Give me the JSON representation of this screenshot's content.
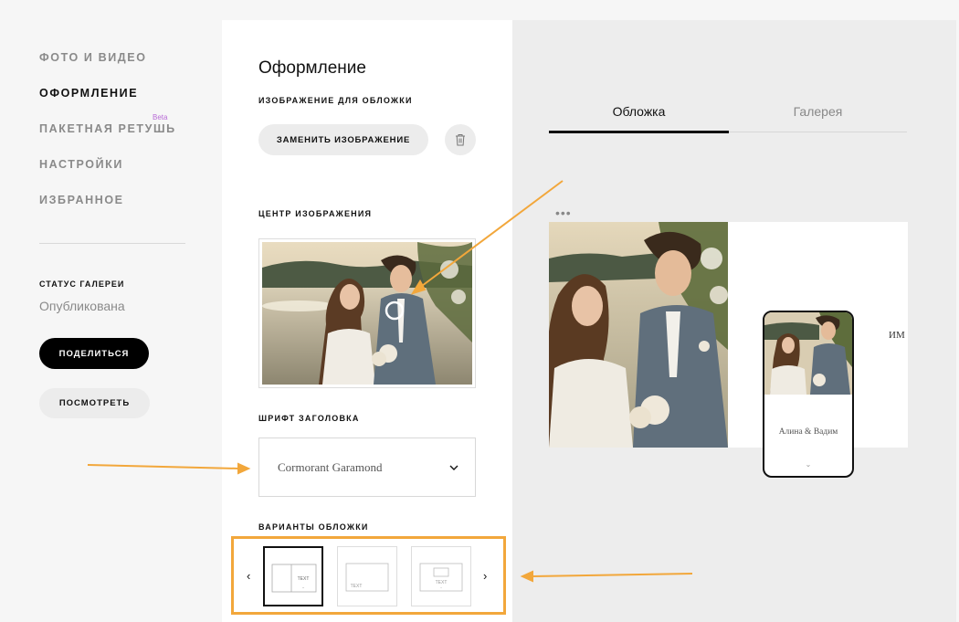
{
  "nav": {
    "items": [
      {
        "label": "ФОТО И ВИДЕО"
      },
      {
        "label": "ОФОРМЛЕНИЕ"
      },
      {
        "label": "ПАКЕТНАЯ РЕТУШЬ"
      },
      {
        "label": "НАСТРОЙКИ"
      },
      {
        "label": "ИЗБРАННОЕ"
      }
    ],
    "beta_badge": "Beta",
    "status_label": "СТАТУС ГАЛЕРЕИ",
    "status_value": "Опубликована",
    "share_label": "ПОДЕЛИТЬСЯ",
    "view_label": "ПОСМОТРЕТЬ"
  },
  "panel": {
    "title": "Оформление",
    "cover_image_label": "ИЗОБРАЖЕНИЕ ДЛЯ ОБЛОЖКИ",
    "replace_label": "ЗАМЕНИТЬ ИЗОБРАЖЕНИЕ",
    "focal_label": "ЦЕНТР ИЗОБРАЖЕНИЯ",
    "font_label": "ШРИФТ ЗАГОЛОВКА",
    "font_value": "Cormorant Garamond",
    "variants_label": "ВАРИАНТЫ ОБЛОЖКИ",
    "variant_thumb_text": "TEXT"
  },
  "preview": {
    "tabs": [
      {
        "label": "Обложка"
      },
      {
        "label": "Галерея"
      }
    ],
    "desktop_title_fragment": "ИМ",
    "phone_title": "Алина & Вадим"
  },
  "colors": {
    "accent_orange": "#f2a73b",
    "black_button": "#000000",
    "muted_text": "#8a8a8a",
    "beta": "#b86bd6"
  },
  "icons": [
    "trash-icon",
    "chevron-down-icon",
    "chevron-left-icon",
    "chevron-right-icon",
    "more-dots-icon",
    "focal-point-icon"
  ]
}
